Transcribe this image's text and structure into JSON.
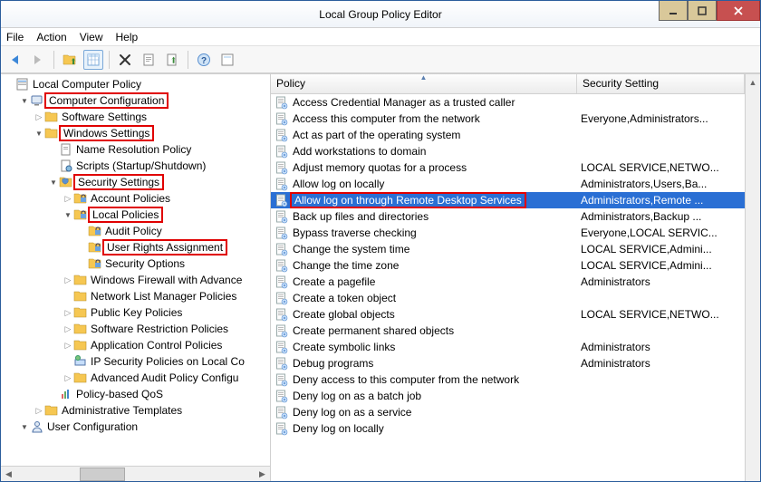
{
  "window": {
    "title": "Local Group Policy Editor"
  },
  "menu": {
    "file": "File",
    "action": "Action",
    "view": "View",
    "help": "Help"
  },
  "list_header": {
    "policy": "Policy",
    "setting": "Security Setting"
  },
  "tree": [
    {
      "indent": 0,
      "tw": "none",
      "icon": "root",
      "label": "Local Computer Policy",
      "hl": false
    },
    {
      "indent": 1,
      "tw": "open",
      "icon": "computer",
      "label": "Computer Configuration",
      "hl": true
    },
    {
      "indent": 2,
      "tw": "closed",
      "icon": "folder",
      "label": "Software Settings",
      "hl": false
    },
    {
      "indent": 2,
      "tw": "open",
      "icon": "folder",
      "label": "Windows Settings",
      "hl": true
    },
    {
      "indent": 3,
      "tw": "none",
      "icon": "doc",
      "label": "Name Resolution Policy",
      "hl": false
    },
    {
      "indent": 3,
      "tw": "none",
      "icon": "script",
      "label": "Scripts (Startup/Shutdown)",
      "hl": false
    },
    {
      "indent": 3,
      "tw": "open",
      "icon": "secset",
      "label": "Security Settings",
      "hl": true
    },
    {
      "indent": 4,
      "tw": "closed",
      "icon": "folder-sec",
      "label": "Account Policies",
      "hl": false
    },
    {
      "indent": 4,
      "tw": "open",
      "icon": "folder-sec",
      "label": "Local Policies",
      "hl": true
    },
    {
      "indent": 5,
      "tw": "none",
      "icon": "folder-sec",
      "label": "Audit Policy",
      "hl": false
    },
    {
      "indent": 5,
      "tw": "none",
      "icon": "folder-sec",
      "label": "User Rights Assignment",
      "hl": true
    },
    {
      "indent": 5,
      "tw": "none",
      "icon": "folder-sec",
      "label": "Security Options",
      "hl": false
    },
    {
      "indent": 4,
      "tw": "closed",
      "icon": "folder",
      "label": "Windows Firewall with Advance",
      "hl": false
    },
    {
      "indent": 4,
      "tw": "none",
      "icon": "folder",
      "label": "Network List Manager Policies",
      "hl": false
    },
    {
      "indent": 4,
      "tw": "closed",
      "icon": "folder",
      "label": "Public Key Policies",
      "hl": false
    },
    {
      "indent": 4,
      "tw": "closed",
      "icon": "folder",
      "label": "Software Restriction Policies",
      "hl": false
    },
    {
      "indent": 4,
      "tw": "closed",
      "icon": "folder",
      "label": "Application Control Policies",
      "hl": false
    },
    {
      "indent": 4,
      "tw": "none",
      "icon": "ipsec",
      "label": "IP Security Policies on Local Co",
      "hl": false
    },
    {
      "indent": 4,
      "tw": "closed",
      "icon": "folder",
      "label": "Advanced Audit Policy Configu",
      "hl": false
    },
    {
      "indent": 3,
      "tw": "none",
      "icon": "qos",
      "label": "Policy-based QoS",
      "hl": false
    },
    {
      "indent": 2,
      "tw": "closed",
      "icon": "folder",
      "label": "Administrative Templates",
      "hl": false
    },
    {
      "indent": 1,
      "tw": "open",
      "icon": "user",
      "label": "User Configuration",
      "hl": false
    }
  ],
  "policies": [
    {
      "name": "Access Credential Manager as a trusted caller",
      "setting": "",
      "selected": false,
      "hl": false
    },
    {
      "name": "Access this computer from the network",
      "setting": "Everyone,Administrators...",
      "selected": false,
      "hl": false
    },
    {
      "name": "Act as part of the operating system",
      "setting": "",
      "selected": false,
      "hl": false
    },
    {
      "name": "Add workstations to domain",
      "setting": "",
      "selected": false,
      "hl": false
    },
    {
      "name": "Adjust memory quotas for a process",
      "setting": "LOCAL SERVICE,NETWO...",
      "selected": false,
      "hl": false
    },
    {
      "name": "Allow log on locally",
      "setting": "Administrators,Users,Ba...",
      "selected": false,
      "hl": false
    },
    {
      "name": "Allow log on through Remote Desktop Services",
      "setting": "Administrators,Remote ...",
      "selected": true,
      "hl": true
    },
    {
      "name": "Back up files and directories",
      "setting": "Administrators,Backup ...",
      "selected": false,
      "hl": false
    },
    {
      "name": "Bypass traverse checking",
      "setting": "Everyone,LOCAL SERVIC...",
      "selected": false,
      "hl": false
    },
    {
      "name": "Change the system time",
      "setting": "LOCAL SERVICE,Admini...",
      "selected": false,
      "hl": false
    },
    {
      "name": "Change the time zone",
      "setting": "LOCAL SERVICE,Admini...",
      "selected": false,
      "hl": false
    },
    {
      "name": "Create a pagefile",
      "setting": "Administrators",
      "selected": false,
      "hl": false
    },
    {
      "name": "Create a token object",
      "setting": "",
      "selected": false,
      "hl": false
    },
    {
      "name": "Create global objects",
      "setting": "LOCAL SERVICE,NETWO...",
      "selected": false,
      "hl": false
    },
    {
      "name": "Create permanent shared objects",
      "setting": "",
      "selected": false,
      "hl": false
    },
    {
      "name": "Create symbolic links",
      "setting": "Administrators",
      "selected": false,
      "hl": false
    },
    {
      "name": "Debug programs",
      "setting": "Administrators",
      "selected": false,
      "hl": false
    },
    {
      "name": "Deny access to this computer from the network",
      "setting": "",
      "selected": false,
      "hl": false
    },
    {
      "name": "Deny log on as a batch job",
      "setting": "",
      "selected": false,
      "hl": false
    },
    {
      "name": "Deny log on as a service",
      "setting": "",
      "selected": false,
      "hl": false
    },
    {
      "name": "Deny log on locally",
      "setting": "",
      "selected": false,
      "hl": false
    }
  ]
}
